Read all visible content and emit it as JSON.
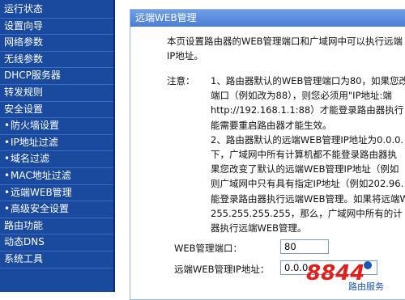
{
  "sidebar": {
    "items": [
      {
        "label": "运行状态",
        "type": "top"
      },
      {
        "label": "设置向导",
        "type": "top"
      },
      {
        "label": "网络参数",
        "type": "top"
      },
      {
        "label": "无线参数",
        "type": "top"
      },
      {
        "label": "DHCP服务器",
        "type": "top"
      },
      {
        "label": "转发规则",
        "type": "top"
      },
      {
        "label": "安全设置",
        "type": "top"
      },
      {
        "label": "防火墙设置",
        "type": "sub"
      },
      {
        "label": "IP地址过滤",
        "type": "sub"
      },
      {
        "label": "域名过滤",
        "type": "sub"
      },
      {
        "label": "MAC地址过滤",
        "type": "sub"
      },
      {
        "label": "远端WEB管理",
        "type": "sub",
        "active": true
      },
      {
        "label": "高级安全设置",
        "type": "sub"
      },
      {
        "label": "路由功能",
        "type": "top"
      },
      {
        "label": "动态DNS",
        "type": "top"
      },
      {
        "label": "系统工具",
        "type": "top"
      }
    ],
    "bullet": "•"
  },
  "panel": {
    "title": "远端WEB管理",
    "intro_line1": "本页设置路由器的WEB管理端口和广域网中可以执行远端",
    "intro_line2": "IP地址。",
    "note_label": "注意：",
    "note_lines": [
      "1、路由器默认的WEB管理端口为80，如果您改变",
      "端口（例如改为88），则您必须用\"IP地址:端",
      "http://192.168.1.1:88）才能登录路由器执行",
      "能需要重启路由器才能生效。",
      "2、路由器默认的远端WEB管理IP地址为0.0.0.",
      "下，广域网中所有计算机都不能登录路由器执",
      "果您改变了默认的远端WEB管理IP地址（例如",
      "则广域网中只有具有指定IP地址（例如202.96.",
      "能登录路由器执行远端WEB管理。如果将远端W",
      "255.255.255.255，那么，广域网中所有的计",
      "器执行远端WEB管理。"
    ],
    "port_label": "WEB管理端口：",
    "port_value": "80",
    "ip_label": "远端WEB管理IP地址：",
    "ip_value": "0.0.0."
  },
  "watermark": {
    "brand": "8844",
    "sub": "路由服务"
  },
  "colors": {
    "sidebar_bg": "#1a4a9e",
    "title_bar": "#5b8ee0",
    "watermark_red": "#e0201e",
    "watermark_blue": "#1b56b0"
  }
}
